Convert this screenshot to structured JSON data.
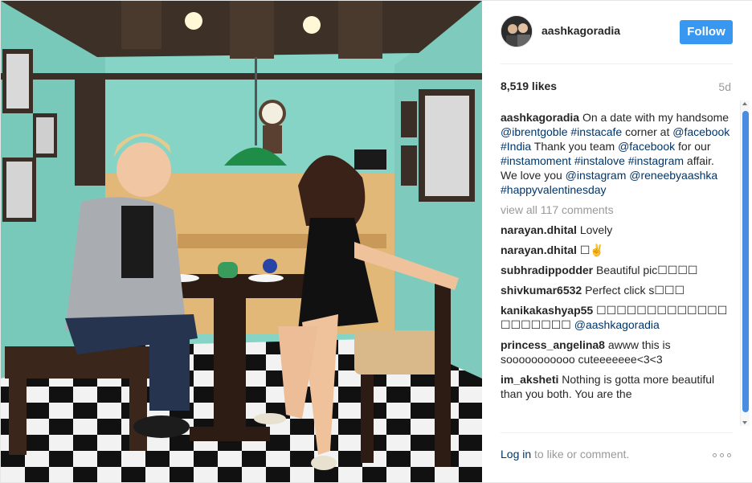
{
  "post": {
    "username": "aashkagoradia",
    "follow_label": "Follow",
    "likes": "8,519 likes",
    "age": "5d",
    "caption_user": "aashkagoradia",
    "caption": [
      {
        "t": "On a date with my handsome ",
        "tag": false
      },
      {
        "t": "@ibrentgoble",
        "tag": true
      },
      {
        "t": " ",
        "tag": false
      },
      {
        "t": "#instacafe",
        "tag": true
      },
      {
        "t": " corner at ",
        "tag": false
      },
      {
        "t": "@facebook",
        "tag": true
      },
      {
        "t": " ",
        "tag": false
      },
      {
        "t": "#India",
        "tag": true
      },
      {
        "t": " Thank you team ",
        "tag": false
      },
      {
        "t": "@facebook",
        "tag": true
      },
      {
        "t": " for our ",
        "tag": false
      },
      {
        "t": "#instamoment",
        "tag": true
      },
      {
        "t": " ",
        "tag": false
      },
      {
        "t": "#instalove",
        "tag": true
      },
      {
        "t": " ",
        "tag": false
      },
      {
        "t": "#instagram",
        "tag": true
      },
      {
        "t": " affair. We love you ",
        "tag": false
      },
      {
        "t": "@instagram",
        "tag": true
      },
      {
        "t": " ",
        "tag": false
      },
      {
        "t": "@reneebyaashka",
        "tag": true
      },
      {
        "t": " ",
        "tag": false
      },
      {
        "t": "#happyvalentinesday",
        "tag": true
      }
    ],
    "view_all": "view all 117 comments",
    "comments": [
      {
        "user": "narayan.dhital",
        "text": "Lovely"
      },
      {
        "user": "narayan.dhital",
        "text": "☐✌"
      },
      {
        "user": "subhradippodder",
        "text": "Beautiful pic☐☐☐☐"
      },
      {
        "user": "shivkumar6532",
        "text": "Perfect click s☐☐☐"
      },
      {
        "user": "kanikakashyap55",
        "text": "☐☐☐☐☐☐☐☐☐☐☐☐☐ ☐☐☐☐☐☐☐ ",
        "mention": "@aashkagoradia"
      },
      {
        "user": "princess_angelina8",
        "text": "awww this is sooooooooooo cuteeeeeee<3<3"
      },
      {
        "user": "im_aksheti",
        "text": "Nothing is gotta more beautiful than you both. You are the"
      }
    ],
    "login_link": "Log in",
    "login_rest": " to like or comment.",
    "icons": {
      "more": "more-options-icon",
      "scroll_up": "scroll-up-arrow-icon",
      "scroll_down": "scroll-down-arrow-icon"
    }
  }
}
